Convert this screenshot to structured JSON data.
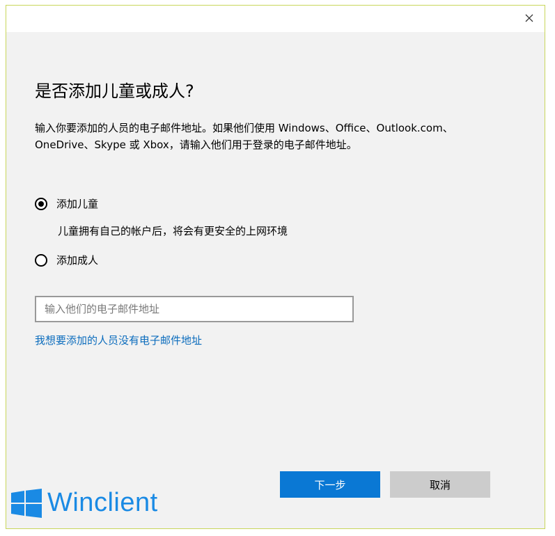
{
  "dialog": {
    "title": "是否添加儿童或成人?",
    "description": "输入你要添加的人员的电子邮件地址。如果他们使用 Windows、Office、Outlook.com、OneDrive、Skype 或 Xbox，请输入他们用于登录的电子邮件地址。",
    "options": [
      {
        "label": "添加儿童",
        "selected": true
      },
      {
        "label": "添加成人",
        "selected": false
      }
    ],
    "child_note": "儿童拥有自己的帐户后，将会有更安全的上网环境",
    "email_placeholder": "输入他们的电子邮件地址",
    "email_value": "",
    "no_email_link": "我想要添加的人员没有电子邮件地址",
    "next_button": "下一步",
    "cancel_button": "取消",
    "close_icon": "close-icon"
  },
  "watermark": {
    "text": "Winclient",
    "logo_icon": "windows-logo-icon"
  },
  "colors": {
    "accent": "#0a78d4",
    "link": "#0b6cbd",
    "background": "#f2f2f2",
    "cancel_bg": "#cccccc",
    "watermark": "#1a8ae4"
  }
}
